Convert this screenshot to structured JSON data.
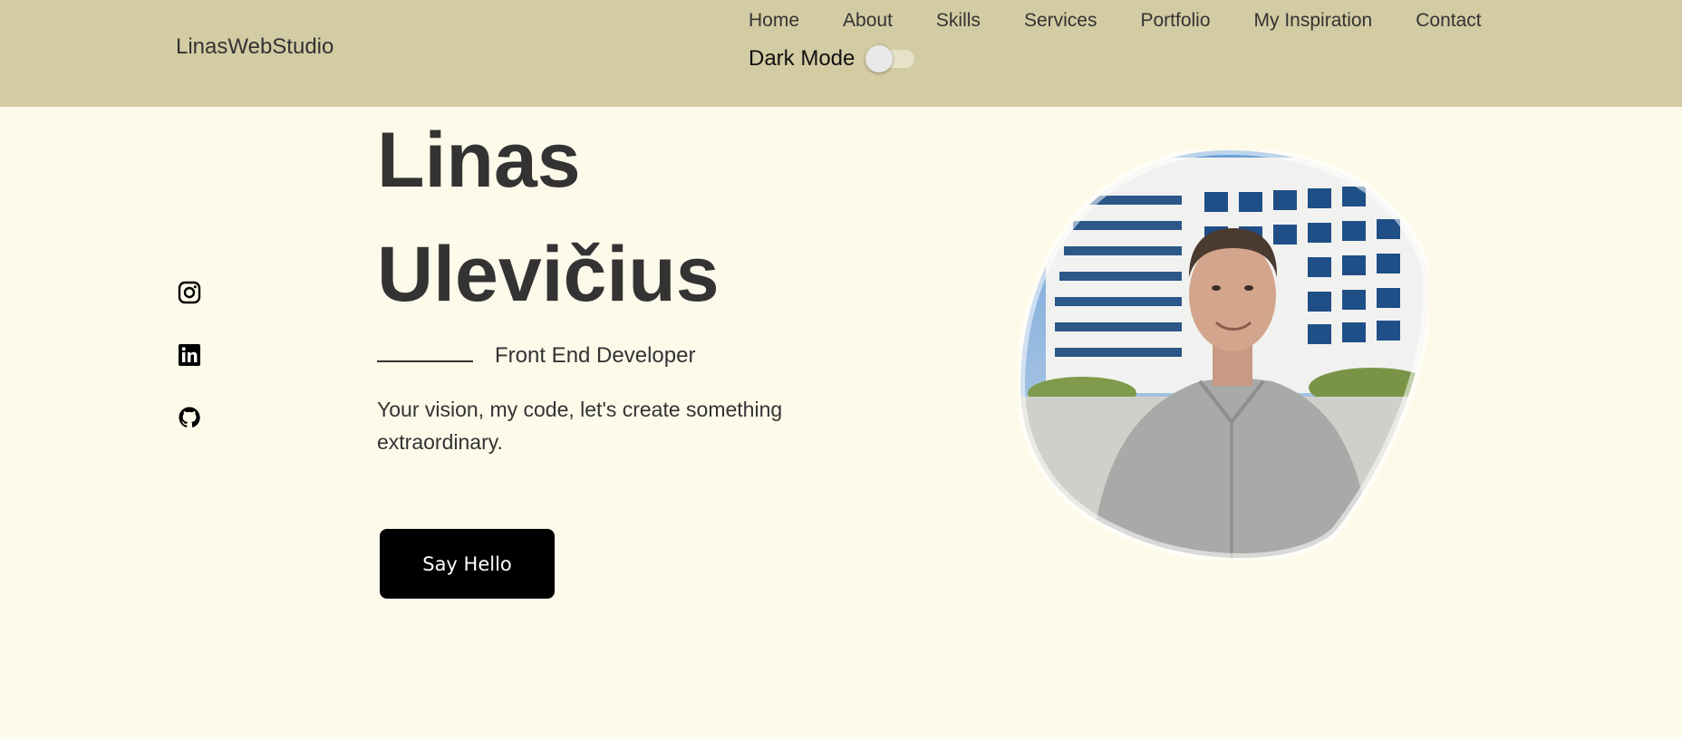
{
  "header": {
    "logo": "LinasWebStudio",
    "nav": [
      "Home",
      "About",
      "Skills",
      "Services",
      "Portfolio",
      "My Inspiration",
      "Contact"
    ],
    "dark_mode_label": "Dark Mode",
    "dark_mode_on": false,
    "background_color": "#d3cba3"
  },
  "social": {
    "icons": [
      "instagram-icon",
      "linkedin-icon",
      "github-icon"
    ]
  },
  "hero": {
    "first_name": "Linas",
    "last_name": "Ulevičius",
    "role": "Front End Developer",
    "tagline": "Your vision, my code, let's create something extraordinary.",
    "cta_label": "Say Hello",
    "background_color": "#fdfaea"
  }
}
